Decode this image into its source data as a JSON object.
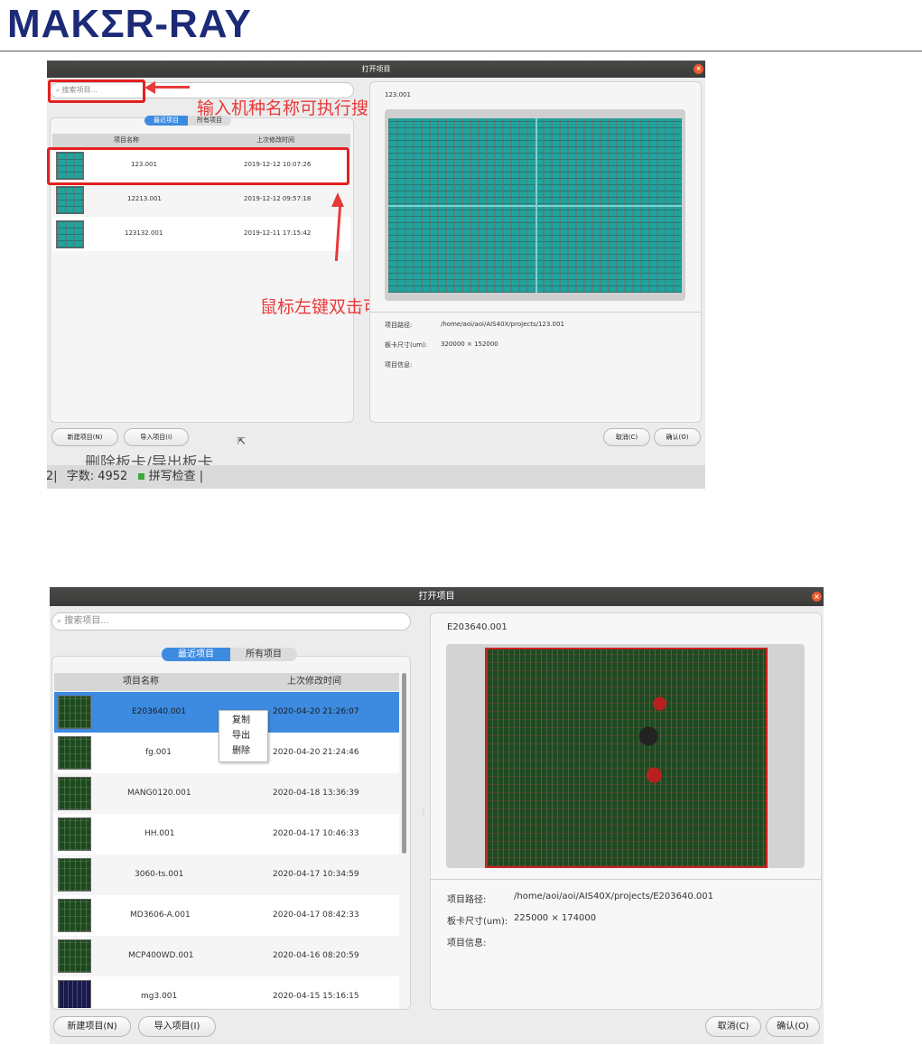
{
  "logo": {
    "text": "MAKΣR-RAY"
  },
  "shot1": {
    "window_title": "打开项目",
    "search_placeholder": "搜索项目...",
    "tabs": [
      "最近项目",
      "所有项目"
    ],
    "columns": [
      "项目名称",
      "上次修改时间"
    ],
    "rows": [
      {
        "name": "123.001",
        "time": "2019-12-12 10:07:26"
      },
      {
        "name": "12213.001",
        "time": "2019-12-12 09:57:18"
      },
      {
        "name": "123132.001",
        "time": "2019-12-11 17:15:42"
      }
    ],
    "preview_title": "123.001",
    "info": {
      "path_label": "项目路径:",
      "path_value": "/home/aoi/aoi/AIS40X/projects/123.001",
      "size_label": "板卡尺寸(um):",
      "size_value": "320000 × 152000",
      "info_label": "项目信息:"
    },
    "buttons": {
      "new": "新建项目(N)",
      "import": "导入项目(I)",
      "cancel": "取消(C)",
      "ok": "确认(O)"
    },
    "annotations": {
      "search": "输入机种名称可执行搜索",
      "dblclick": "鼠标左键双击可打开程序"
    },
    "overflow_text": "删除板卡/导出板卡",
    "status": {
      "left": "|: 2|",
      "words": "字数: 4952",
      "spell": "拼写检查",
      "end": "|"
    }
  },
  "shot2": {
    "window_title": "打开项目",
    "search_placeholder": "搜索项目...",
    "tabs": [
      "最近项目",
      "所有项目"
    ],
    "columns": [
      "项目名称",
      "上次修改时间"
    ],
    "rows": [
      {
        "name": "E203640.001",
        "time": "2020-04-20 21:26:07",
        "selected": true
      },
      {
        "name": "fg.001",
        "time": "2020-04-20 21:24:46"
      },
      {
        "name": "MANG0120.001",
        "time": "2020-04-18 13:36:39"
      },
      {
        "name": "HH.001",
        "time": "2020-04-17 10:46:33"
      },
      {
        "name": "3060-ts.001",
        "time": "2020-04-17 10:34:59"
      },
      {
        "name": "MD3606-A.001",
        "time": "2020-04-17 08:42:33"
      },
      {
        "name": "MCP400WD.001",
        "time": "2020-04-16 08:20:59"
      },
      {
        "name": "mg3.001",
        "time": "2020-04-15 15:16:15"
      }
    ],
    "context_menu": [
      "复制",
      "导出",
      "删除"
    ],
    "preview_title": "E203640.001",
    "info": {
      "path_label": "项目路径:",
      "path_value": "/home/aoi/aoi/AIS40X/projects/E203640.001",
      "size_label": "板卡尺寸(um):",
      "size_value": "225000 × 174000",
      "info_label": "项目信息:"
    },
    "buttons": {
      "new": "新建项目(N)",
      "import": "导入项目(I)",
      "cancel": "取消(C)",
      "ok": "确认(O)"
    }
  },
  "colors": {
    "accent": "#3d8be0",
    "annotation": "#e83a3a",
    "logo": "#1c2a78"
  }
}
